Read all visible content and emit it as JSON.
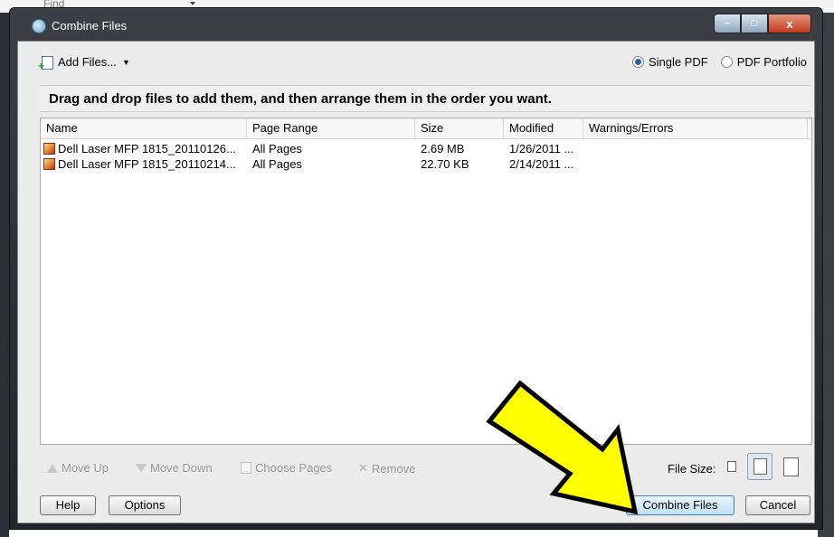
{
  "background": {
    "find_label": "Find"
  },
  "window": {
    "title": "Combine Files",
    "controls": {
      "minimize": "‒",
      "maximize": "□",
      "close": "x"
    }
  },
  "toolbar": {
    "add_files_label": "Add Files...",
    "output_options": [
      {
        "label": "Single PDF",
        "selected": true
      },
      {
        "label": "PDF Portfolio",
        "selected": false
      }
    ]
  },
  "instructions": "Drag and drop files to add them, and then arrange them in the order you want.",
  "file_list": {
    "columns": [
      "Name",
      "Page Range",
      "Size",
      "Modified",
      "Warnings/Errors"
    ],
    "rows": [
      {
        "name": "Dell Laser MFP 1815_20110126...",
        "page_range": "All Pages",
        "size": "2.69 MB",
        "modified": "1/26/2011 ...",
        "warnings": ""
      },
      {
        "name": "Dell Laser MFP 1815_20110214...",
        "page_range": "All Pages",
        "size": "22.70 KB",
        "modified": "2/14/2011 ...",
        "warnings": ""
      }
    ]
  },
  "actions": {
    "move_up": "Move Up",
    "move_down": "Move Down",
    "choose_pages": "Choose Pages",
    "remove": "Remove",
    "file_size_label": "File Size:",
    "file_size_selected": "medium"
  },
  "buttons": {
    "help": "Help",
    "options": "Options",
    "combine": "Combine Files",
    "cancel": "Cancel"
  },
  "colors": {
    "annotation_arrow": "#ffff00",
    "primary_button": "#bfe2f8",
    "titlebar": "#2c3036"
  }
}
